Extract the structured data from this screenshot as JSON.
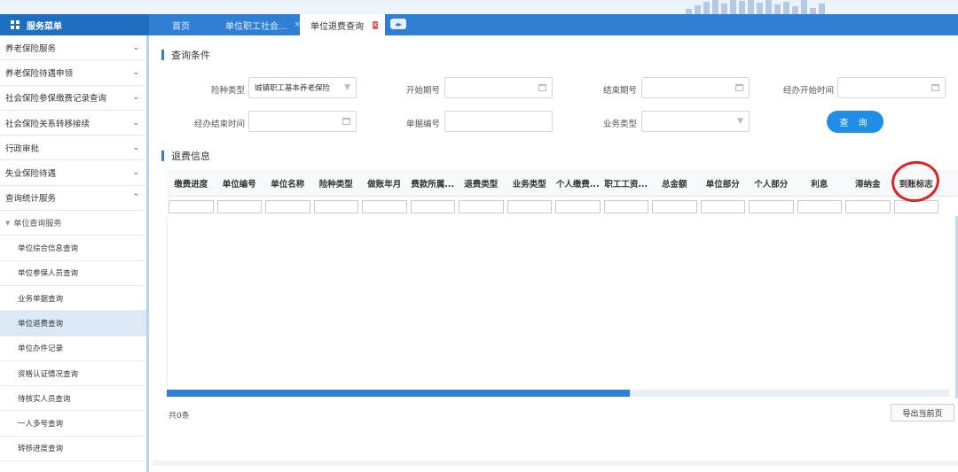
{
  "brand": {
    "title": "服务菜单"
  },
  "tabs": [
    {
      "label": "首页"
    },
    {
      "label": "单位职工社会...",
      "close": "×"
    },
    {
      "label": "单位退费查询",
      "close": "×"
    }
  ],
  "sidebar": {
    "items": [
      {
        "label": "养老保险服务",
        "chevron": "⌄"
      },
      {
        "label": "养老保险待遇申领",
        "chevron": "⌄"
      },
      {
        "label": "社会保险参保缴费记录查询",
        "chevron": "⌄"
      },
      {
        "label": "社会保险关系转移接续",
        "chevron": "⌄"
      },
      {
        "label": "行政审批",
        "chevron": "⌄"
      },
      {
        "label": "失业保险待遇",
        "chevron": "⌄"
      },
      {
        "label": "查询统计服务",
        "chevron": "⌃"
      }
    ],
    "group": {
      "label": "单位查询服务",
      "marker": "▼"
    },
    "sub_items": [
      {
        "label": "单位综合信息查询"
      },
      {
        "label": "单位参保人员查询"
      },
      {
        "label": "业务单据查询"
      },
      {
        "label": "单位退费查询"
      },
      {
        "label": "单位办件记录"
      },
      {
        "label": "资格认证情况查询"
      },
      {
        "label": "待核实人员查询"
      },
      {
        "label": "一人多号查询"
      },
      {
        "label": "转移进度查询"
      }
    ],
    "active_sub": "单位退费查询"
  },
  "query": {
    "section_title": "查询条件",
    "insurance_type": {
      "label": "险种类型",
      "value": "城镇职工基本养老保险",
      "icon": "▼"
    },
    "start_period": {
      "label": "开始期号",
      "value": ""
    },
    "end_period": {
      "label": "结束期号",
      "value": ""
    },
    "handle_start": {
      "label": "经办开始时间",
      "value": ""
    },
    "handle_end": {
      "label": "经办结束时间",
      "value": ""
    },
    "doc_no": {
      "label": "单据编号",
      "value": ""
    },
    "biz_type": {
      "label": "业务类型",
      "value": "",
      "icon": "▼"
    },
    "query_button": "查 询"
  },
  "refund": {
    "section_title": "退费信息",
    "columns": [
      "缴费进度",
      "单位编号",
      "单位名称",
      "险种类型",
      "做账年月",
      "费款所属...",
      "退费类型",
      "业务类型",
      "个人缴费...",
      "职工工资...",
      "总金额",
      "单位部分",
      "个人部分",
      "利息",
      "滞纳金",
      "到账标志"
    ],
    "rows": [],
    "total_text": "共0条",
    "export_button": "导出当前页"
  },
  "annotation_color": "#e02323",
  "accent_color": "#2f7fd4"
}
